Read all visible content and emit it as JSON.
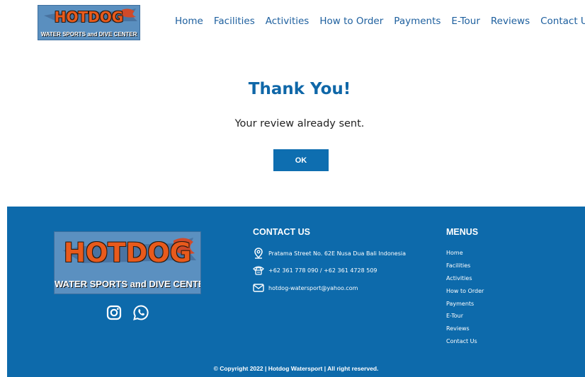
{
  "header": {
    "logo": {
      "main": "HOTDOG",
      "sub": "WATER SPORTS and DIVE CENTER"
    },
    "nav": [
      {
        "label": "Home"
      },
      {
        "label": "Facilities"
      },
      {
        "label": "Activities"
      },
      {
        "label": "How to Order"
      },
      {
        "label": "Payments"
      },
      {
        "label": "E-Tour"
      },
      {
        "label": "Reviews"
      },
      {
        "label": "Contact Us"
      }
    ]
  },
  "main": {
    "title": "Thank You!",
    "message": "Your review already sent.",
    "ok_label": "OK"
  },
  "footer": {
    "logo": {
      "main": "HOTDOG",
      "sub": "WATER SPORTS and DIVE CENTER"
    },
    "socials": [
      {
        "icon": "instagram-icon"
      },
      {
        "icon": "whatsapp-icon"
      }
    ],
    "contact": {
      "title": "CONTACT US",
      "address": "Pratama Street No. 62E Nusa Dua Bali Indonesia",
      "phone": "+62 361 778 090 / +62 361 4728 509",
      "email": "hotdog-watersport@yahoo.com"
    },
    "menus": {
      "title": "MENUS",
      "items": [
        {
          "label": "Home"
        },
        {
          "label": "Facilities"
        },
        {
          "label": "Activities"
        },
        {
          "label": "How to Order"
        },
        {
          "label": "Payments"
        },
        {
          "label": "E-Tour"
        },
        {
          "label": "Reviews"
        },
        {
          "label": "Contact Us"
        }
      ]
    },
    "copyright": "© Copyright 2022 | Hotdog Watersport | All right reserved."
  },
  "colors": {
    "brand_blue": "#0d6aab",
    "nav_text": "#1d5f9e",
    "title_blue": "#0f67a8",
    "logo_orange": "#e85a1c"
  }
}
